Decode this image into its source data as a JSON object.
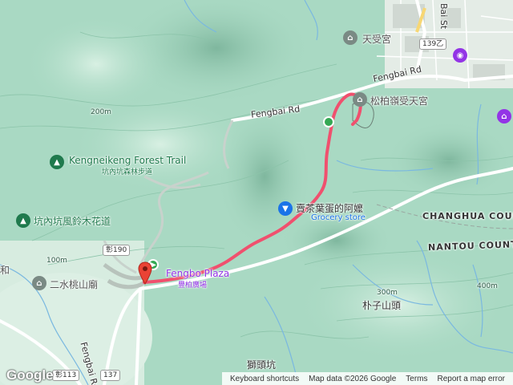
{
  "map": {
    "places": {
      "kengneikeng_trail_en": "Kengneikeng Forest Trail",
      "kengneikeng_trail_zh": "坑內坑森林步道",
      "kengneikeng_flower_trail": "坑內坑風鈴木花道",
      "ershui_temple": "二水桃山廟",
      "tianshou_temple": "天受宮",
      "songbai_temple": "松柏嶺受天宮",
      "tea_egg_shop": "賣茶葉蛋的阿嬤",
      "tea_egg_category": "Grocery store",
      "fengbo_plaza_en": "Fengbo Plaza",
      "fengbo_plaza_zh": "豐柏廣場",
      "zizi_hill": "朴子山頭",
      "shitou_keng": "獅頭坑",
      "he_char": "和"
    },
    "roads": {
      "fengbai_rd_1": "Fengbai Rd",
      "fengbai_rd_2": "Fengbai Rd",
      "fengbai_rd_3": "Fengbai Rd",
      "bai_st": "Bai St"
    },
    "shields": {
      "r139": "139乙",
      "r190": "彰190",
      "r137": "137",
      "r113": "彰113"
    },
    "counties": {
      "changhua": "CHANGHUA COUN",
      "nantou": "NANTOU COUNTY"
    },
    "contours": {
      "c200m": "200m",
      "c100m": "100m",
      "c300m": "300m",
      "c400m": "400m"
    },
    "attribution": {
      "logo": "Google",
      "shortcuts": "Keyboard shortcuts",
      "data": "Map data ©2026 Google",
      "terms": "Terms",
      "report": "Report a map error"
    },
    "colors": {
      "terrain": "#a9d9c3",
      "route": "#f0506e",
      "poi_green": "#1f7a4d",
      "poi_blue": "#1a73e8",
      "poi_purple": "#9334e6",
      "start_pin": "#34a853",
      "end_pin": "#ea4335"
    }
  }
}
